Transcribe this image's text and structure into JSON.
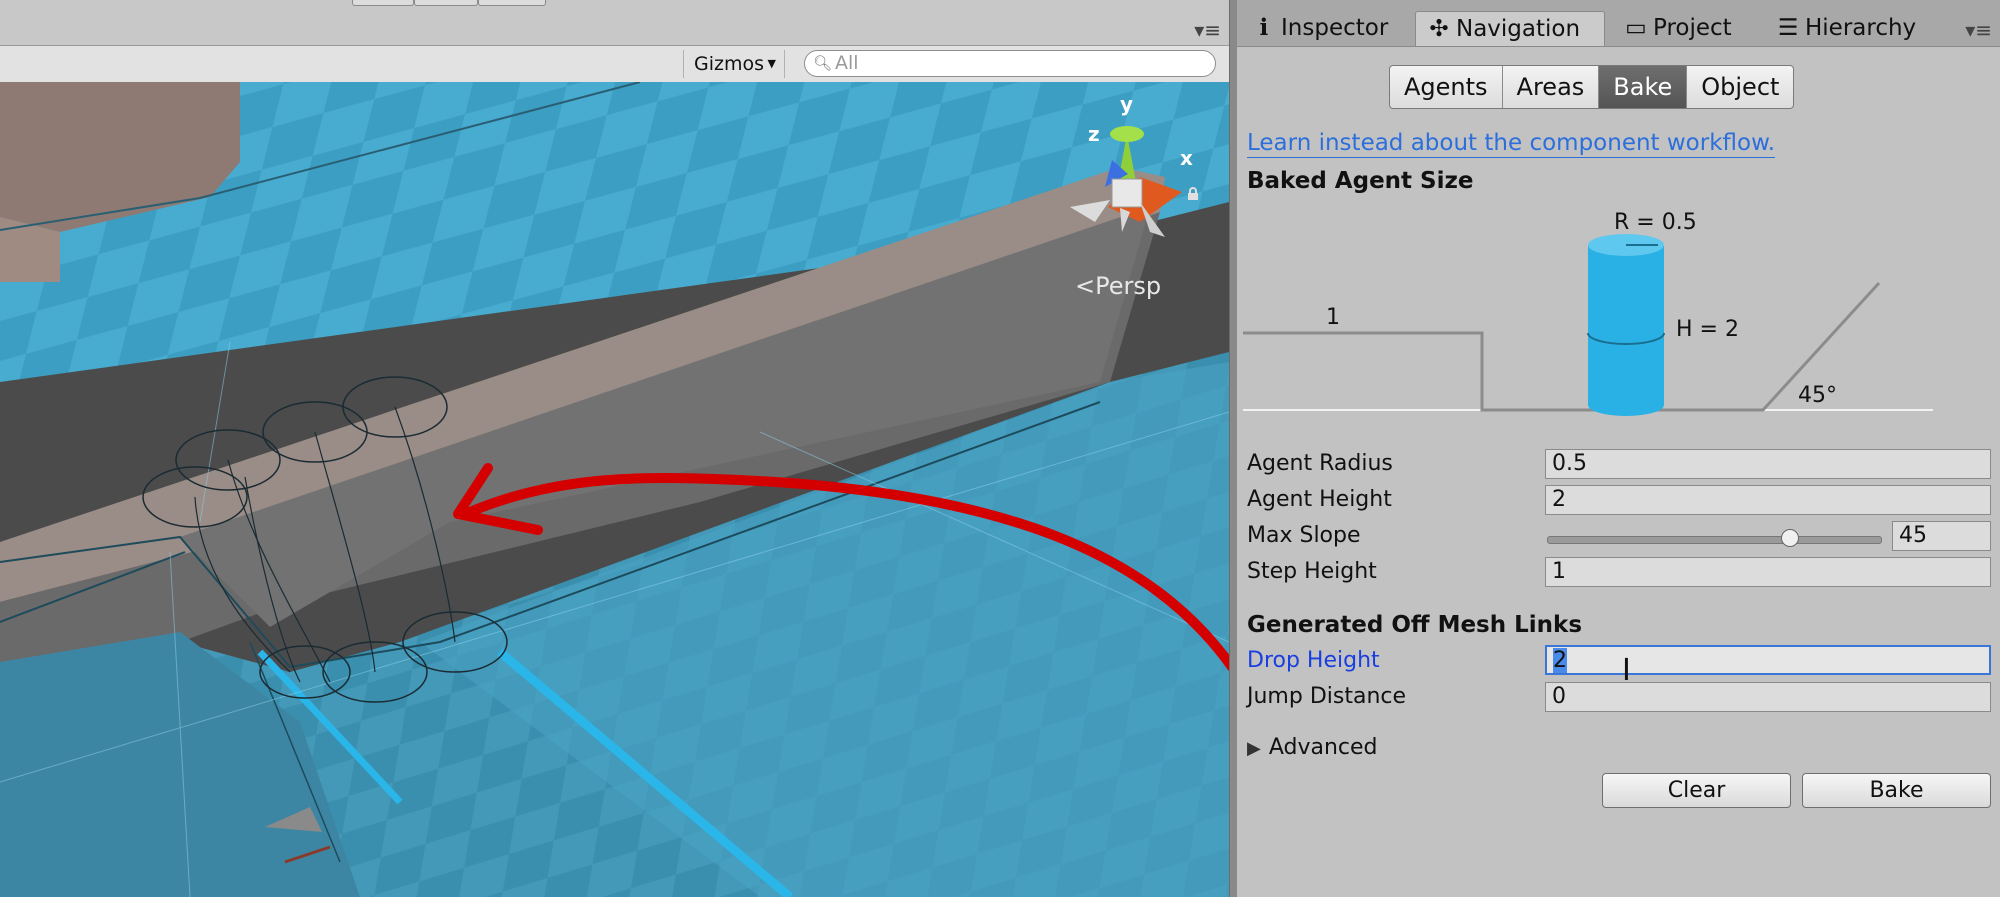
{
  "scene": {
    "gizmos_label": "Gizmos",
    "search_placeholder": "All",
    "persp_label": "Persp",
    "axes": {
      "x": "x",
      "y": "y",
      "z": "z"
    }
  },
  "tabs": [
    {
      "label": "Inspector",
      "icon": "info-icon"
    },
    {
      "label": "Navigation",
      "icon": "navigation-icon",
      "active": true
    },
    {
      "label": "Project",
      "icon": "folder-icon"
    },
    {
      "label": "Hierarchy",
      "icon": "hierarchy-icon"
    }
  ],
  "nav_modes": [
    "Agents",
    "Areas",
    "Bake",
    "Object"
  ],
  "nav_active_mode": "Bake",
  "learn_link": "Learn instead about the component workflow.",
  "baked_agent_size": {
    "title": "Baked Agent Size",
    "radius_label": "R = 0.5",
    "height_label": "H = 2",
    "step_label": "1",
    "slope_label": "45°"
  },
  "fields": {
    "agent_radius": {
      "label": "Agent Radius",
      "value": "0.5"
    },
    "agent_height": {
      "label": "Agent Height",
      "value": "2"
    },
    "max_slope": {
      "label": "Max Slope",
      "value": "45",
      "slider_fraction": 0.75
    },
    "step_height": {
      "label": "Step Height",
      "value": "1"
    }
  },
  "offmesh": {
    "title": "Generated Off Mesh Links",
    "drop_height": {
      "label": "Drop Height",
      "value": "2"
    },
    "jump_distance": {
      "label": "Jump Distance",
      "value": "0"
    }
  },
  "advanced_label": "Advanced",
  "buttons": {
    "clear": "Clear",
    "bake": "Bake"
  },
  "colors": {
    "navmesh": "#3fa9cf",
    "annotation_arrow": "#d40000",
    "active_field_border": "#3a76d8",
    "link_text": "#2c6fdc",
    "agent_cylinder": "#29b0e4"
  }
}
